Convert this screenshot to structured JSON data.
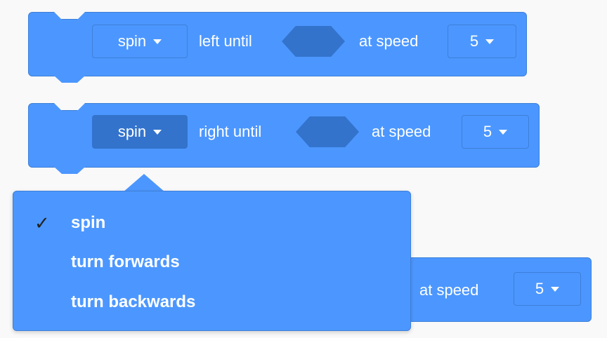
{
  "block1": {
    "mode": "spin",
    "direction_text": "left until",
    "speed_label": "at speed",
    "speed_value": "5"
  },
  "block2": {
    "mode": "spin",
    "direction_text": "right until",
    "speed_label": "at speed",
    "speed_value": "5"
  },
  "block3": {
    "speed_label": "at speed",
    "speed_value": "5"
  },
  "dropdown": {
    "items": [
      {
        "label": "spin",
        "checked": true,
        "check_glyph": "✓"
      },
      {
        "label": "turn forwards",
        "checked": false
      },
      {
        "label": "turn backwards",
        "checked": false
      }
    ]
  },
  "colors": {
    "block": "#4c97ff",
    "block_border": "#3d7fd9",
    "active_field": "#3373cc"
  }
}
